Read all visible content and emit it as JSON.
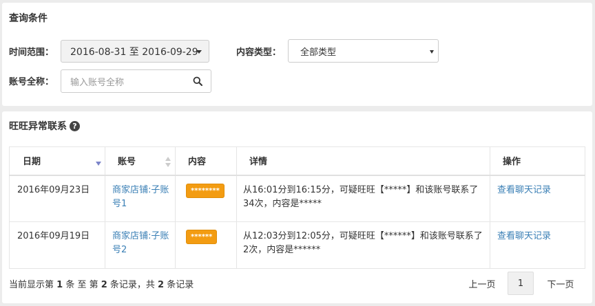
{
  "query": {
    "title": "查询条件",
    "time_label": "时间范围：",
    "date_range": "2016-08-31 至 2016-09-29",
    "type_label": "内容类型：",
    "type_value": "全部类型",
    "account_label": "账号全称：",
    "account_placeholder": "输入账号全称"
  },
  "result": {
    "title": "旺旺异常联系",
    "help_glyph": "?",
    "columns": [
      "日期",
      "账号",
      "内容",
      "详情",
      "操作"
    ],
    "rows": [
      {
        "date": "2016年09月23日",
        "account": "商家店铺:子账号1",
        "content": "********",
        "detail": "从16:01分到16:15分，可疑旺旺【*****】和该账号联系了34次，内容是*****",
        "action": "查看聊天记录"
      },
      {
        "date": "2016年09月19日",
        "account": "商家店铺:子账号2",
        "content": "******",
        "detail": "从12:03分到12:05分，可疑旺旺【******】和该账号联系了2次，内容是******",
        "action": "查看聊天记录"
      }
    ],
    "footer": {
      "t1": "当前显示第 ",
      "start": "1",
      "t2": " 条 至 第 ",
      "end": "2",
      "t3": " 条记录，共 ",
      "total": "2",
      "t4": " 条记录"
    },
    "pager": {
      "prev": "上一页",
      "page": "1",
      "next": "下一页"
    }
  },
  "colors": {
    "link": "#3a7fb5",
    "badge": "#f39c12",
    "sort_active": "#7b84c9"
  }
}
